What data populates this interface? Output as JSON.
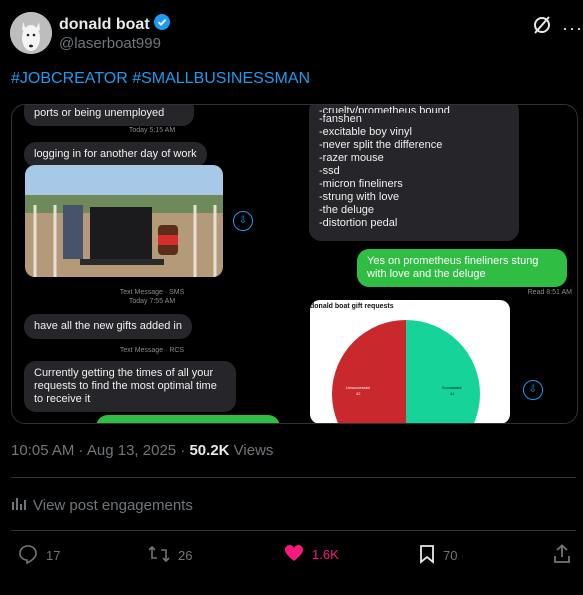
{
  "author": {
    "name": "donald boat",
    "handle": "@laserboat999",
    "verified": true
  },
  "post": {
    "text": "#JOBCREATOR #SMALLBUSINESSMAN",
    "time": "10:05 AM · Aug 13, 2025 ·",
    "views_count": "50.2K",
    "views_label": "Views"
  },
  "media": {
    "left_top_text": "ports or being unemployed",
    "meta1": "Today 5:15 AM",
    "bubble1": "logging in for another day of work",
    "meta2a": "Text Message · SMS",
    "meta2b": "Today 7:55 AM",
    "bubble2": "have all the new gifts added in",
    "meta3": "Text Message · RCS",
    "bubble3": "Currently getting the times of all your requests to find the most optimal time to receive it",
    "list_lines": [
      "-cruelty/prometheus bound",
      "-fanshen",
      "-excitable boy vinyl",
      "-never split the difference",
      "-razer mouse",
      "-ssd",
      "-micron fineliners",
      "-strung with love",
      "-the deluge",
      "-distortion pedal"
    ],
    "reply": "Yes on prometheus fineliners stung with love and the deluge",
    "read": "Read 8:51 AM",
    "chart_title": "donald boat gift requests",
    "slice_left_label": "Unsuccessful",
    "slice_left_value": "42",
    "slice_right_label": "Successful",
    "slice_right_value": "41"
  },
  "engagements_label": "View post engagements",
  "actions": {
    "replies": "17",
    "reposts": "26",
    "likes": "1.6K",
    "bookmarks": "70"
  },
  "colors": {
    "accent": "#1d9bf0",
    "like": "#f91880",
    "pie_left": "#c9282d",
    "pie_right": "#16d39a",
    "imessage_green": "#2fbd44"
  }
}
